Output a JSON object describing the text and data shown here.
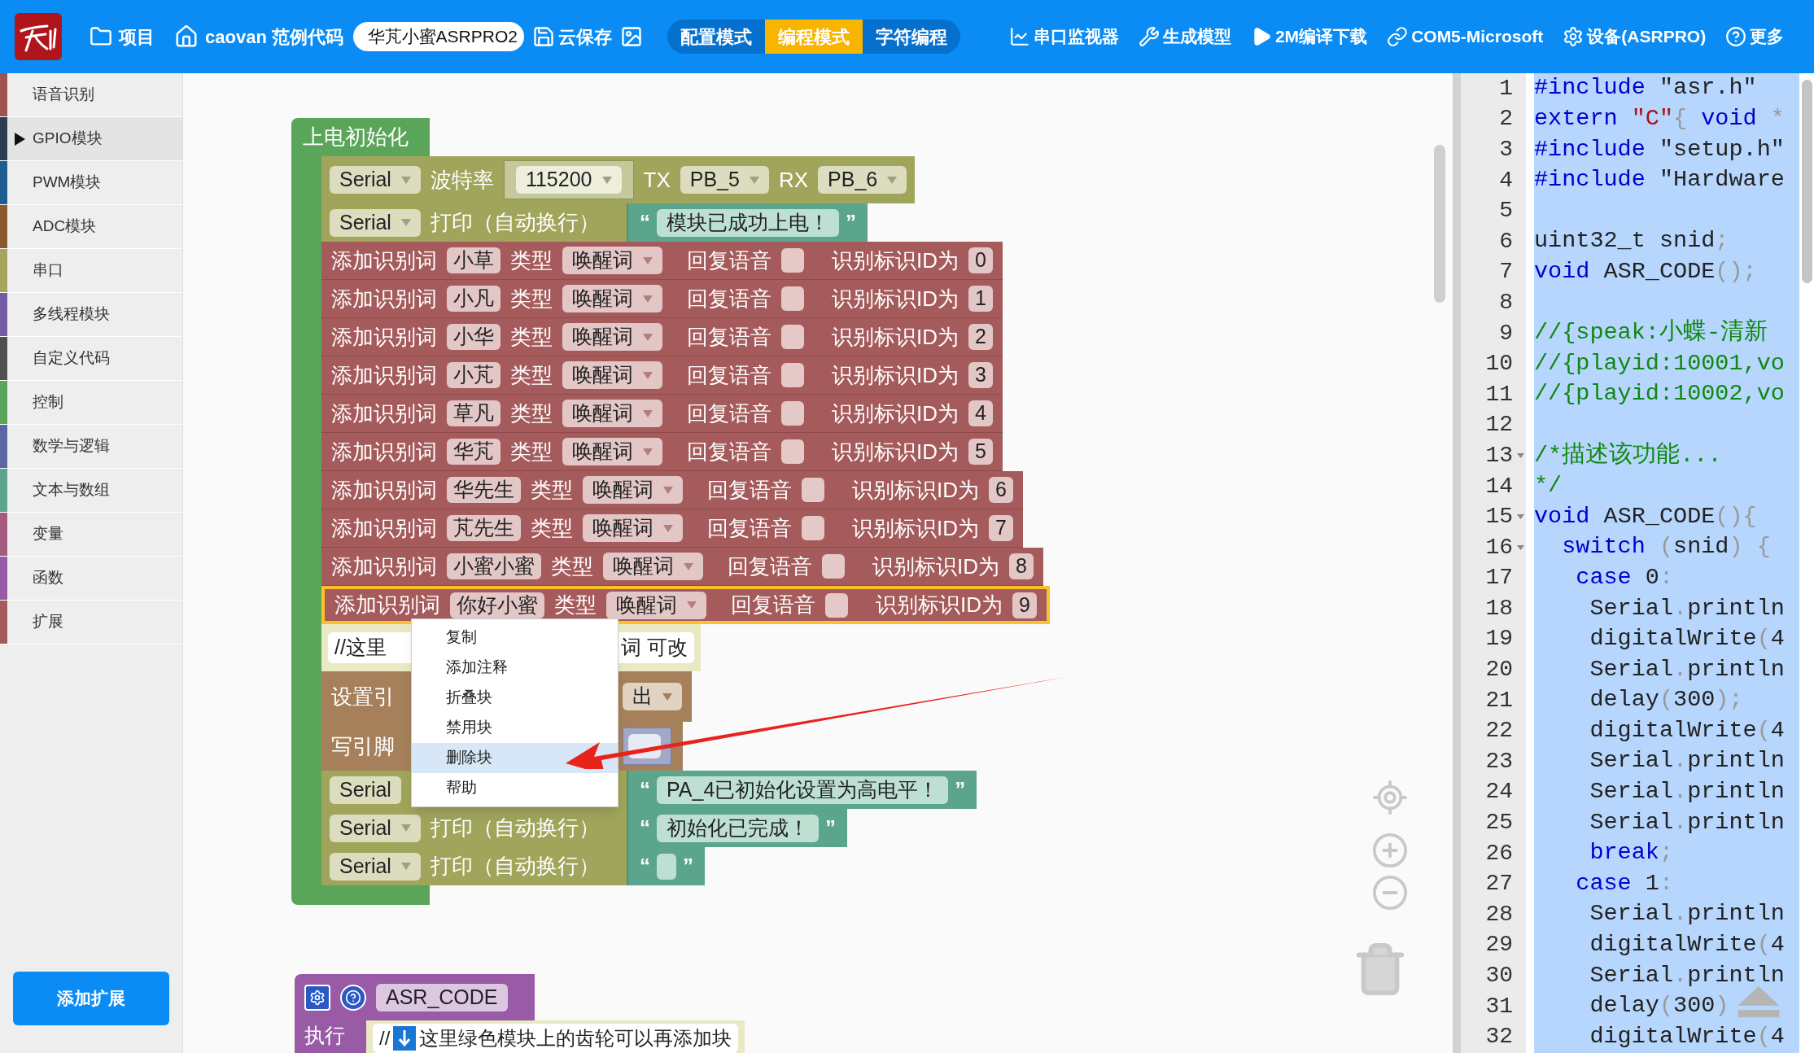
{
  "toolbar": {
    "project": "项目",
    "examples": "caovan 范例代码",
    "file_name": "华芃小蜜ASRPRO2",
    "cloud_save": "云保存",
    "modes": [
      {
        "label": "配置模式",
        "selected": false
      },
      {
        "label": "编程模式",
        "selected": true
      },
      {
        "label": "字符编程",
        "selected": false
      }
    ],
    "actions": [
      {
        "kind": "monitor",
        "label": "串口监视器"
      },
      {
        "kind": "model",
        "label": "生成模型"
      },
      {
        "kind": "download",
        "label": "2M编译下载"
      },
      {
        "kind": "port",
        "label": "COM5-Microsoft"
      },
      {
        "kind": "device",
        "label": "设备(ASRPRO)"
      },
      {
        "kind": "help",
        "label": "更多"
      }
    ]
  },
  "sidebar": {
    "categories": [
      {
        "label": "语音识别",
        "color": "#a0524f",
        "selected": false
      },
      {
        "label": "GPIO模块",
        "color": "#2c3e50",
        "selected": true
      },
      {
        "label": "PWM模块",
        "color": "#1f5c8f",
        "selected": false
      },
      {
        "label": "ADC模块",
        "color": "#8a5a2e",
        "selected": false
      },
      {
        "label": "串口",
        "color": "#a5a55b",
        "selected": false
      },
      {
        "label": "多线程模块",
        "color": "#745ba5",
        "selected": false
      },
      {
        "label": "自定义代码",
        "color": "#505050",
        "selected": false
      },
      {
        "label": "控制",
        "color": "#5ba55b",
        "selected": false
      },
      {
        "label": "数学与逻辑",
        "color": "#5b67a5",
        "selected": false
      },
      {
        "label": "文本与数组",
        "color": "#5ba58c",
        "selected": false
      },
      {
        "label": "变量",
        "color": "#a55b80",
        "selected": false
      },
      {
        "label": "函数",
        "color": "#995ba5",
        "selected": false
      },
      {
        "label": "扩展",
        "color": "#a55b5b",
        "selected": false
      }
    ],
    "add_extension": "添加扩展"
  },
  "setup_block": {
    "title": "上电初始化",
    "statements": [
      {
        "kind": "serial_begin",
        "selected": false,
        "port": "Serial",
        "label": "波特率",
        "baud": "115200",
        "tx_label": "TX",
        "tx": "PB_5",
        "rx_label": "RX",
        "rx": "PB_6"
      },
      {
        "kind": "serial_print",
        "selected": false,
        "port": "Serial",
        "port_dropdown": true,
        "label": "打印（自动换行）",
        "quotes": [
          "“",
          "”"
        ],
        "text": "模块已成功上电！"
      },
      {
        "kind": "add_word",
        "selected": false,
        "label": "添加识别词",
        "word": "小草",
        "type_label": "类型",
        "type": "唤醒词",
        "reply_label": "回复语音",
        "reply": false,
        "id_label": "识别标识ID为",
        "id": "0"
      },
      {
        "kind": "add_word",
        "selected": false,
        "label": "添加识别词",
        "word": "小凡",
        "type_label": "类型",
        "type": "唤醒词",
        "reply_label": "回复语音",
        "reply": false,
        "id_label": "识别标识ID为",
        "id": "1"
      },
      {
        "kind": "add_word",
        "selected": false,
        "label": "添加识别词",
        "word": "小华",
        "type_label": "类型",
        "type": "唤醒词",
        "reply_label": "回复语音",
        "reply": false,
        "id_label": "识别标识ID为",
        "id": "2"
      },
      {
        "kind": "add_word",
        "selected": false,
        "label": "添加识别词",
        "word": "小芃",
        "type_label": "类型",
        "type": "唤醒词",
        "reply_label": "回复语音",
        "reply": false,
        "id_label": "识别标识ID为",
        "id": "3"
      },
      {
        "kind": "add_word",
        "selected": false,
        "label": "添加识别词",
        "word": "草凡",
        "type_label": "类型",
        "type": "唤醒词",
        "reply_label": "回复语音",
        "reply": false,
        "id_label": "识别标识ID为",
        "id": "4"
      },
      {
        "kind": "add_word",
        "selected": false,
        "label": "添加识别词",
        "word": "华芃",
        "type_label": "类型",
        "type": "唤醒词",
        "reply_label": "回复语音",
        "reply": false,
        "id_label": "识别标识ID为",
        "id": "5"
      },
      {
        "kind": "add_word",
        "selected": false,
        "label": "添加识别词",
        "word": "华先生",
        "type_label": "类型",
        "type": "唤醒词",
        "reply_label": "回复语音",
        "reply": false,
        "id_label": "识别标识ID为",
        "id": "6"
      },
      {
        "kind": "add_word",
        "selected": false,
        "label": "添加识别词",
        "word": "芃先生",
        "type_label": "类型",
        "type": "唤醒词",
        "reply_label": "回复语音",
        "reply": false,
        "id_label": "识别标识ID为",
        "id": "7"
      },
      {
        "kind": "add_word",
        "selected": false,
        "label": "添加识别词",
        "word": "小蜜小蜜",
        "type_label": "类型",
        "type": "唤醒词",
        "reply_label": "回复语音",
        "reply": false,
        "id_label": "识别标识ID为",
        "id": "8"
      },
      {
        "kind": "add_word",
        "selected": true,
        "label": "添加识别词",
        "word": "你好小蜜",
        "type_label": "类型",
        "type": "唤醒词",
        "reply_label": "回复语音",
        "reply": false,
        "id_label": "识别标识ID为",
        "id": "9"
      },
      {
        "kind": "comment",
        "selected": false,
        "text_start": "//这里",
        "text_end": "词 可改"
      },
      {
        "kind": "pin_mode",
        "selected": false,
        "label": "设置引",
        "mode": "出"
      },
      {
        "kind": "write_pin",
        "selected": false,
        "label": "写引脚"
      },
      {
        "kind": "serial_print",
        "selected": false,
        "port": "Serial",
        "port_dropdown": false,
        "quotes": [
          "“",
          "”"
        ],
        "text": "PA_4已初始化设置为高电平！"
      },
      {
        "kind": "serial_print",
        "selected": false,
        "port": "Serial",
        "port_dropdown": true,
        "label": "打印（自动换行）",
        "quotes": [
          "“",
          "”"
        ],
        "text": "初始化已完成！"
      },
      {
        "kind": "serial_print",
        "selected": false,
        "port": "Serial",
        "port_dropdown": true,
        "label": "打印（自动换行）",
        "quotes": [
          "“",
          "”"
        ]
      }
    ]
  },
  "context_menu": [
    {
      "label": "复制",
      "highlighted": false
    },
    {
      "label": "添加注释",
      "highlighted": false
    },
    {
      "label": "折叠块",
      "highlighted": false
    },
    {
      "label": "禁用块",
      "highlighted": false
    },
    {
      "label": "删除块",
      "highlighted": true
    },
    {
      "label": "帮助",
      "highlighted": false
    }
  ],
  "function_block": {
    "name": "ASR_CODE",
    "body_label": "执行",
    "comment_prefix": "//",
    "comment": "这里绿色模块上的齿轮可以再添加块"
  },
  "code_editor": {
    "lines": [
      {
        "n": "1",
        "fold": false,
        "tokens": [
          {
            "kind": "keyword",
            "text": "#include"
          },
          {
            "kind": "plain",
            "text": " \"asr.h\""
          }
        ]
      },
      {
        "n": "2",
        "fold": false,
        "tokens": [
          {
            "kind": "keyword",
            "text": "extern"
          },
          {
            "kind": "string",
            "text": " \"C\""
          },
          {
            "kind": "punct",
            "text": "{"
          },
          {
            "kind": "keyword",
            "text": " void"
          },
          {
            "kind": "punct",
            "text": " *"
          }
        ]
      },
      {
        "n": "3",
        "fold": false,
        "tokens": [
          {
            "kind": "keyword",
            "text": "#include"
          },
          {
            "kind": "plain",
            "text": " \"setup.h\""
          }
        ]
      },
      {
        "n": "4",
        "fold": false,
        "tokens": [
          {
            "kind": "keyword",
            "text": "#include"
          },
          {
            "kind": "plain",
            "text": " \"Hardware"
          }
        ]
      },
      {
        "n": "5",
        "fold": false
      },
      {
        "n": "6",
        "fold": false,
        "tokens": [
          {
            "kind": "plain",
            "text": "uint32_t snid"
          },
          {
            "kind": "punct",
            "text": ";"
          }
        ]
      },
      {
        "n": "7",
        "fold": false,
        "tokens": [
          {
            "kind": "keyword",
            "text": "void"
          },
          {
            "kind": "plain",
            "text": " ASR_CODE"
          },
          {
            "kind": "punct",
            "text": "();"
          }
        ]
      },
      {
        "n": "8",
        "fold": false
      },
      {
        "n": "9",
        "fold": false,
        "tokens": [
          {
            "kind": "comment",
            "text": "//{speak:小蝶-清新"
          }
        ]
      },
      {
        "n": "10",
        "fold": false,
        "tokens": [
          {
            "kind": "comment",
            "text": "//{playid:10001,vo"
          }
        ]
      },
      {
        "n": "11",
        "fold": false,
        "tokens": [
          {
            "kind": "comment",
            "text": "//{playid:10002,vo"
          }
        ]
      },
      {
        "n": "12",
        "fold": false
      },
      {
        "n": "13",
        "fold": true,
        "tokens": [
          {
            "kind": "comment",
            "text": "/*描述该功能..."
          }
        ]
      },
      {
        "n": "14",
        "fold": false,
        "tokens": [
          {
            "kind": "comment",
            "text": "*/"
          }
        ]
      },
      {
        "n": "15",
        "fold": true,
        "tokens": [
          {
            "kind": "keyword",
            "text": "void"
          },
          {
            "kind": "plain",
            "text": " ASR_CODE"
          },
          {
            "kind": "punct",
            "text": "(){"
          }
        ]
      },
      {
        "n": "16",
        "fold": true,
        "tokens": [
          {
            "kind": "keyword",
            "text": "  switch"
          },
          {
            "kind": "punct",
            "text": " ("
          },
          {
            "kind": "plain",
            "text": "snid"
          },
          {
            "kind": "punct",
            "text": ") {"
          }
        ]
      },
      {
        "n": "17",
        "fold": false,
        "tokens": [
          {
            "kind": "keyword",
            "text": "   case"
          },
          {
            "kind": "plain",
            "text": " 0"
          },
          {
            "kind": "punct",
            "text": ":"
          }
        ]
      },
      {
        "n": "18",
        "fold": false,
        "tokens": [
          {
            "kind": "plain",
            "text": "    Serial"
          },
          {
            "kind": "punct",
            "text": "."
          },
          {
            "kind": "plain",
            "text": "println"
          }
        ]
      },
      {
        "n": "19",
        "fold": false,
        "tokens": [
          {
            "kind": "plain",
            "text": "    digitalWrite"
          },
          {
            "kind": "punct",
            "text": "("
          },
          {
            "kind": "plain",
            "text": "4"
          }
        ]
      },
      {
        "n": "20",
        "fold": false,
        "tokens": [
          {
            "kind": "plain",
            "text": "    Serial"
          },
          {
            "kind": "punct",
            "text": "."
          },
          {
            "kind": "plain",
            "text": "println"
          }
        ]
      },
      {
        "n": "21",
        "fold": false,
        "tokens": [
          {
            "kind": "plain",
            "text": "    delay"
          },
          {
            "kind": "punct",
            "text": "("
          },
          {
            "kind": "plain",
            "text": "300"
          },
          {
            "kind": "punct",
            "text": ");"
          }
        ]
      },
      {
        "n": "22",
        "fold": false,
        "tokens": [
          {
            "kind": "plain",
            "text": "    digitalWrite"
          },
          {
            "kind": "punct",
            "text": "("
          },
          {
            "kind": "plain",
            "text": "4"
          }
        ]
      },
      {
        "n": "23",
        "fold": false,
        "tokens": [
          {
            "kind": "plain",
            "text": "    Serial"
          },
          {
            "kind": "punct",
            "text": "."
          },
          {
            "kind": "plain",
            "text": "println"
          }
        ]
      },
      {
        "n": "24",
        "fold": false,
        "tokens": [
          {
            "kind": "plain",
            "text": "    Serial"
          },
          {
            "kind": "punct",
            "text": "."
          },
          {
            "kind": "plain",
            "text": "println"
          }
        ]
      },
      {
        "n": "25",
        "fold": false,
        "tokens": [
          {
            "kind": "plain",
            "text": "    Serial"
          },
          {
            "kind": "punct",
            "text": "."
          },
          {
            "kind": "plain",
            "text": "println"
          }
        ]
      },
      {
        "n": "26",
        "fold": false,
        "tokens": [
          {
            "kind": "keyword",
            "text": "    break"
          },
          {
            "kind": "punct",
            "text": ";"
          }
        ]
      },
      {
        "n": "27",
        "fold": false,
        "tokens": [
          {
            "kind": "keyword",
            "text": "   case"
          },
          {
            "kind": "plain",
            "text": " 1"
          },
          {
            "kind": "punct",
            "text": ":"
          }
        ]
      },
      {
        "n": "28",
        "fold": false,
        "tokens": [
          {
            "kind": "plain",
            "text": "    Serial"
          },
          {
            "kind": "punct",
            "text": "."
          },
          {
            "kind": "plain",
            "text": "println"
          }
        ]
      },
      {
        "n": "29",
        "fold": false,
        "tokens": [
          {
            "kind": "plain",
            "text": "    digitalWrite"
          },
          {
            "kind": "punct",
            "text": "("
          },
          {
            "kind": "plain",
            "text": "4"
          }
        ]
      },
      {
        "n": "30",
        "fold": false,
        "tokens": [
          {
            "kind": "plain",
            "text": "    Serial"
          },
          {
            "kind": "punct",
            "text": "."
          },
          {
            "kind": "plain",
            "text": "println"
          }
        ]
      },
      {
        "n": "31",
        "fold": false,
        "tokens": [
          {
            "kind": "plain",
            "text": "    delay"
          },
          {
            "kind": "punct",
            "text": "("
          },
          {
            "kind": "plain",
            "text": "300"
          },
          {
            "kind": "punct",
            "text": ")"
          }
        ]
      },
      {
        "n": "32",
        "fold": false,
        "tokens": [
          {
            "kind": "plain",
            "text": "    digitalWrite"
          },
          {
            "kind": "punct",
            "text": "("
          },
          {
            "kind": "plain",
            "text": "4"
          }
        ]
      }
    ]
  }
}
